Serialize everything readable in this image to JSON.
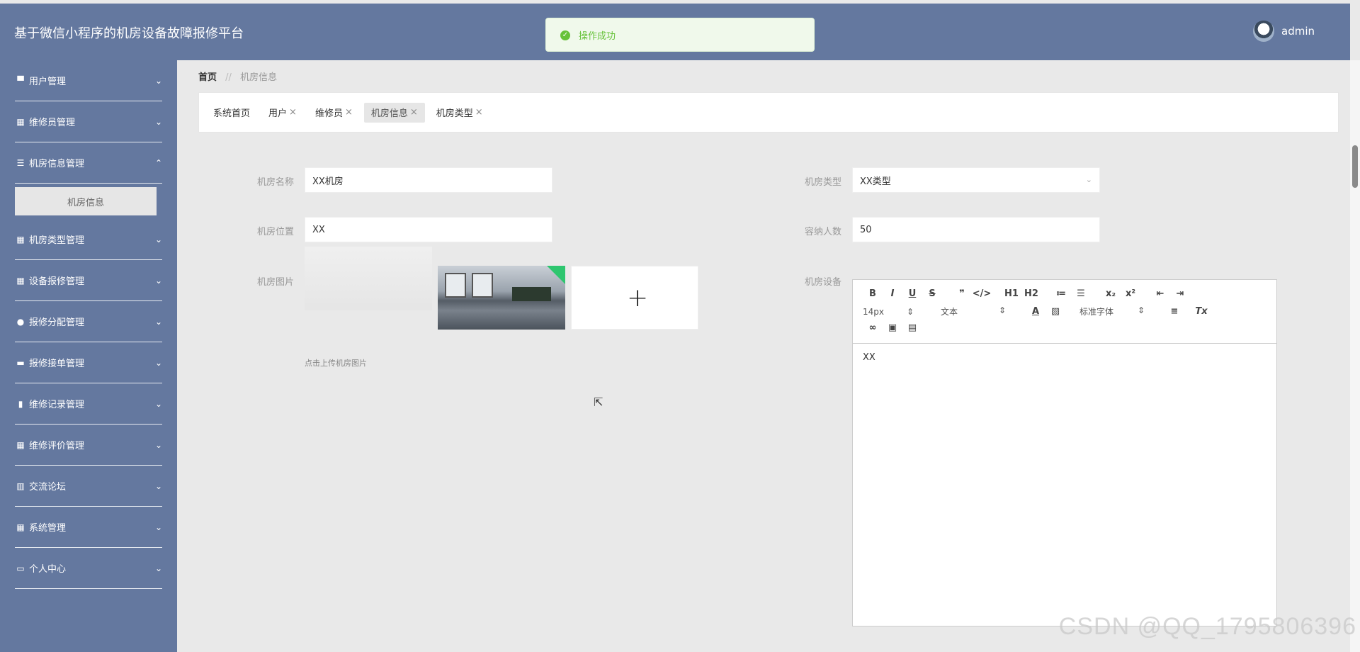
{
  "header": {
    "title": "基于微信小程序的机房设备故障报修平台",
    "toast": "操作成功",
    "username": "admin"
  },
  "sidebar": {
    "items": [
      {
        "label": "用户管理",
        "icon": "user-card-icon",
        "chevron": "⌄"
      },
      {
        "label": "维修员管理",
        "icon": "grid-icon",
        "chevron": "⌄"
      },
      {
        "label": "机房信息管理",
        "icon": "list-icon",
        "chevron": "⌃"
      },
      {
        "label": "机房类型管理",
        "icon": "grid-icon",
        "chevron": "⌄"
      },
      {
        "label": "设备报修管理",
        "icon": "grid-icon",
        "chevron": "⌄"
      },
      {
        "label": "报修分配管理",
        "icon": "person-icon",
        "chevron": "⌄"
      },
      {
        "label": "报修接单管理",
        "icon": "monitor-icon",
        "chevron": "⌄"
      },
      {
        "label": "维修记录管理",
        "icon": "clipboard-icon",
        "chevron": "⌄"
      },
      {
        "label": "维修评价管理",
        "icon": "grid-icon",
        "chevron": "⌄"
      },
      {
        "label": "交流论坛",
        "icon": "bar-chart-icon",
        "chevron": "⌄"
      },
      {
        "label": "系统管理",
        "icon": "grid-icon",
        "chevron": "⌄"
      },
      {
        "label": "个人中心",
        "icon": "id-card-icon",
        "chevron": "⌄"
      }
    ],
    "submenu_label": "机房信息"
  },
  "breadcrumb": {
    "home": "首页",
    "separator": "//",
    "current": "机房信息"
  },
  "tabs": [
    {
      "label": "系统首页",
      "closable": false
    },
    {
      "label": "用户",
      "closable": true
    },
    {
      "label": "维修员",
      "closable": true
    },
    {
      "label": "机房信息",
      "closable": true,
      "active": true
    },
    {
      "label": "机房类型",
      "closable": true
    }
  ],
  "form": {
    "name_label": "机房名称",
    "name_value": "XX机房",
    "location_label": "机房位置",
    "location_value": "XX",
    "image_label": "机房图片",
    "upload_hint": "点击上传机房图片",
    "type_label": "机房类型",
    "type_value": "XX类型",
    "capacity_label": "容纳人数",
    "capacity_value": "50",
    "equipment_label": "机房设备",
    "equipment_value": "XX"
  },
  "editor_toolbar": {
    "font_size": "14px",
    "paragraph": "文本",
    "font_family": "标准字体",
    "row1": [
      "B",
      "I",
      "U",
      "S",
      "❞",
      "</>",
      "H1",
      "H2",
      "≔",
      "☰",
      "x₂",
      "x²",
      "⇤",
      "⇥"
    ]
  },
  "watermark": "CSDN @QQ_1795806396",
  "colors": {
    "header_bg": "#64789f",
    "sidebar_bg": "#64789f",
    "toast_text": "#67c23a"
  }
}
